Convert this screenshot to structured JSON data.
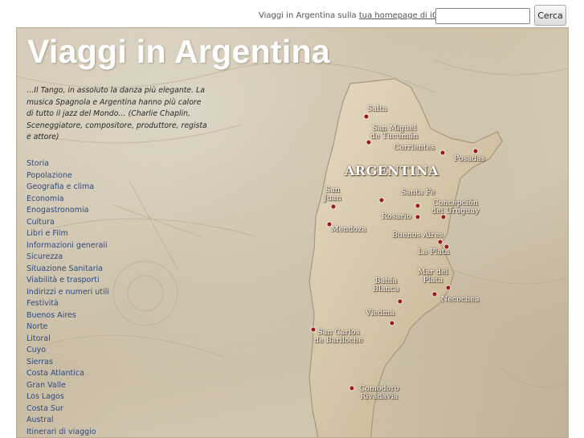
{
  "topbar": {
    "text_prefix": "Viaggi in Argentina sulla",
    "link": "tua homepage di iGoogle",
    "search_value": "",
    "search_button": "Cerca"
  },
  "site": {
    "title": "Viaggi in Argentina",
    "quote": "…Il Tango, in assoluto la danza più elegante. La musica Spagnola e Argentina hanno più calore di tutto il jazz del Mondo… (Charlie Chaplin, Sceneggiatore, compositore, produttore, regista e attore)"
  },
  "nav": {
    "items": [
      {
        "label": "Storia"
      },
      {
        "label": "Popolazione"
      },
      {
        "label": "Geografia e clima"
      },
      {
        "label": "Economia"
      },
      {
        "label": "Enogastronomia"
      },
      {
        "label": "Cultura"
      },
      {
        "label": "Libri e Film"
      },
      {
        "label": "Informazioni generali"
      },
      {
        "label": "Sicurezza"
      },
      {
        "label": "Situazione Sanitaria"
      },
      {
        "label": "Viabilità e trasporti"
      },
      {
        "label": "Indirizzi e numeri utili"
      },
      {
        "label": "Festività"
      },
      {
        "label": "Buenos Aires"
      },
      {
        "label": "Norte"
      },
      {
        "label": "Litoral"
      },
      {
        "label": "Cuyo"
      },
      {
        "label": "Sierras"
      },
      {
        "label": "Costa Atlantica"
      },
      {
        "label": "Gran Valle"
      },
      {
        "label": "Los Lagos"
      },
      {
        "label": "Costa Sur"
      },
      {
        "label": "Austral"
      },
      {
        "label": "Itinerari di viaggio"
      }
    ]
  },
  "map": {
    "title": "ARGENTINA",
    "cities": {
      "salta": "Salta",
      "tucuman_1": "San Miguel",
      "tucuman_2": "de Tucumán",
      "corrientes": "Corrientes",
      "posadas": "Posadas",
      "san_juan_1": "San",
      "san_juan_2": "Juan",
      "santa_fe": "Santa Fe",
      "concepcion_1": "Concepción",
      "concepcion_2": "del Uruguay",
      "rosario": "Rosario",
      "mendoza": "Mendoza",
      "buenos_aires": "Buenos Aires",
      "la_plata": "La Plata",
      "mar_del_plata_1": "Mar del",
      "mar_del_plata_2": "Plata",
      "bahia_blanca_1": "Bahía",
      "bahia_blanca_2": "Blanca",
      "necochea": "Necochea",
      "viedma": "Viedma",
      "bariloche_1": "San Carlos",
      "bariloche_2": "de Bariloche",
      "comodoro_1": "Comodoro",
      "comodoro_2": "Rivadavia"
    },
    "marker_color": "#9b1c1c"
  }
}
